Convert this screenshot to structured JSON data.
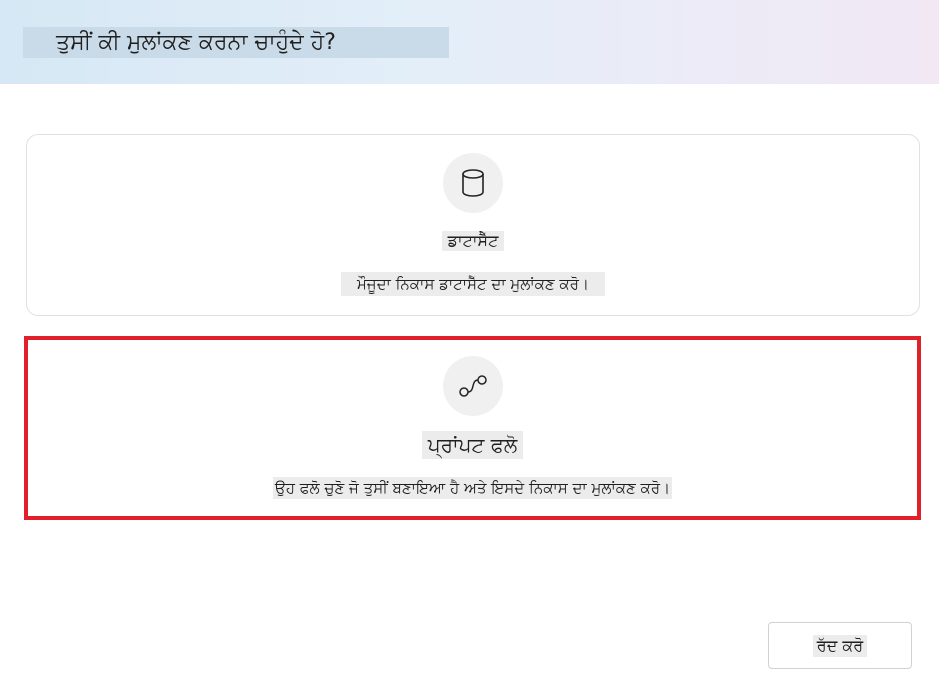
{
  "dialog": {
    "title": "ਤੁਸੀਂ ਕੀ ਮੁਲਾਂਕਣ ਕਰਨਾ ਚਾਹੁੰਦੇ ਹੋ?"
  },
  "options": [
    {
      "icon": "database-icon",
      "title": "ਡਾਟਾਸੈੱਟ",
      "description": "ਮੌਜੂਦਾ ਨਿਕਾਸ ਡਾਟਾਸੈੱਟ ਦਾ ਮੁਲਾਂਕਣ ਕਰੋ।"
    },
    {
      "icon": "prompt-flow-icon",
      "title": "ਪ੍ਰਾਂਪਟ ਫਲੋ",
      "description": "ਉਹ ਫਲੋ ਚੁਣੋ ਜੋ ਤੁਸੀਂ ਬਣਾਇਆ ਹੈ ਅਤੇ ਇਸਦੇ ਨਿਕਾਸ ਦਾ ਮੁਲਾਂਕਣ ਕਰੋ।",
      "highlighted": true
    }
  ],
  "footer": {
    "cancel_label": "ਰੱਦ ਕਰੋ"
  },
  "colors": {
    "highlight_border": "#e0202a"
  }
}
